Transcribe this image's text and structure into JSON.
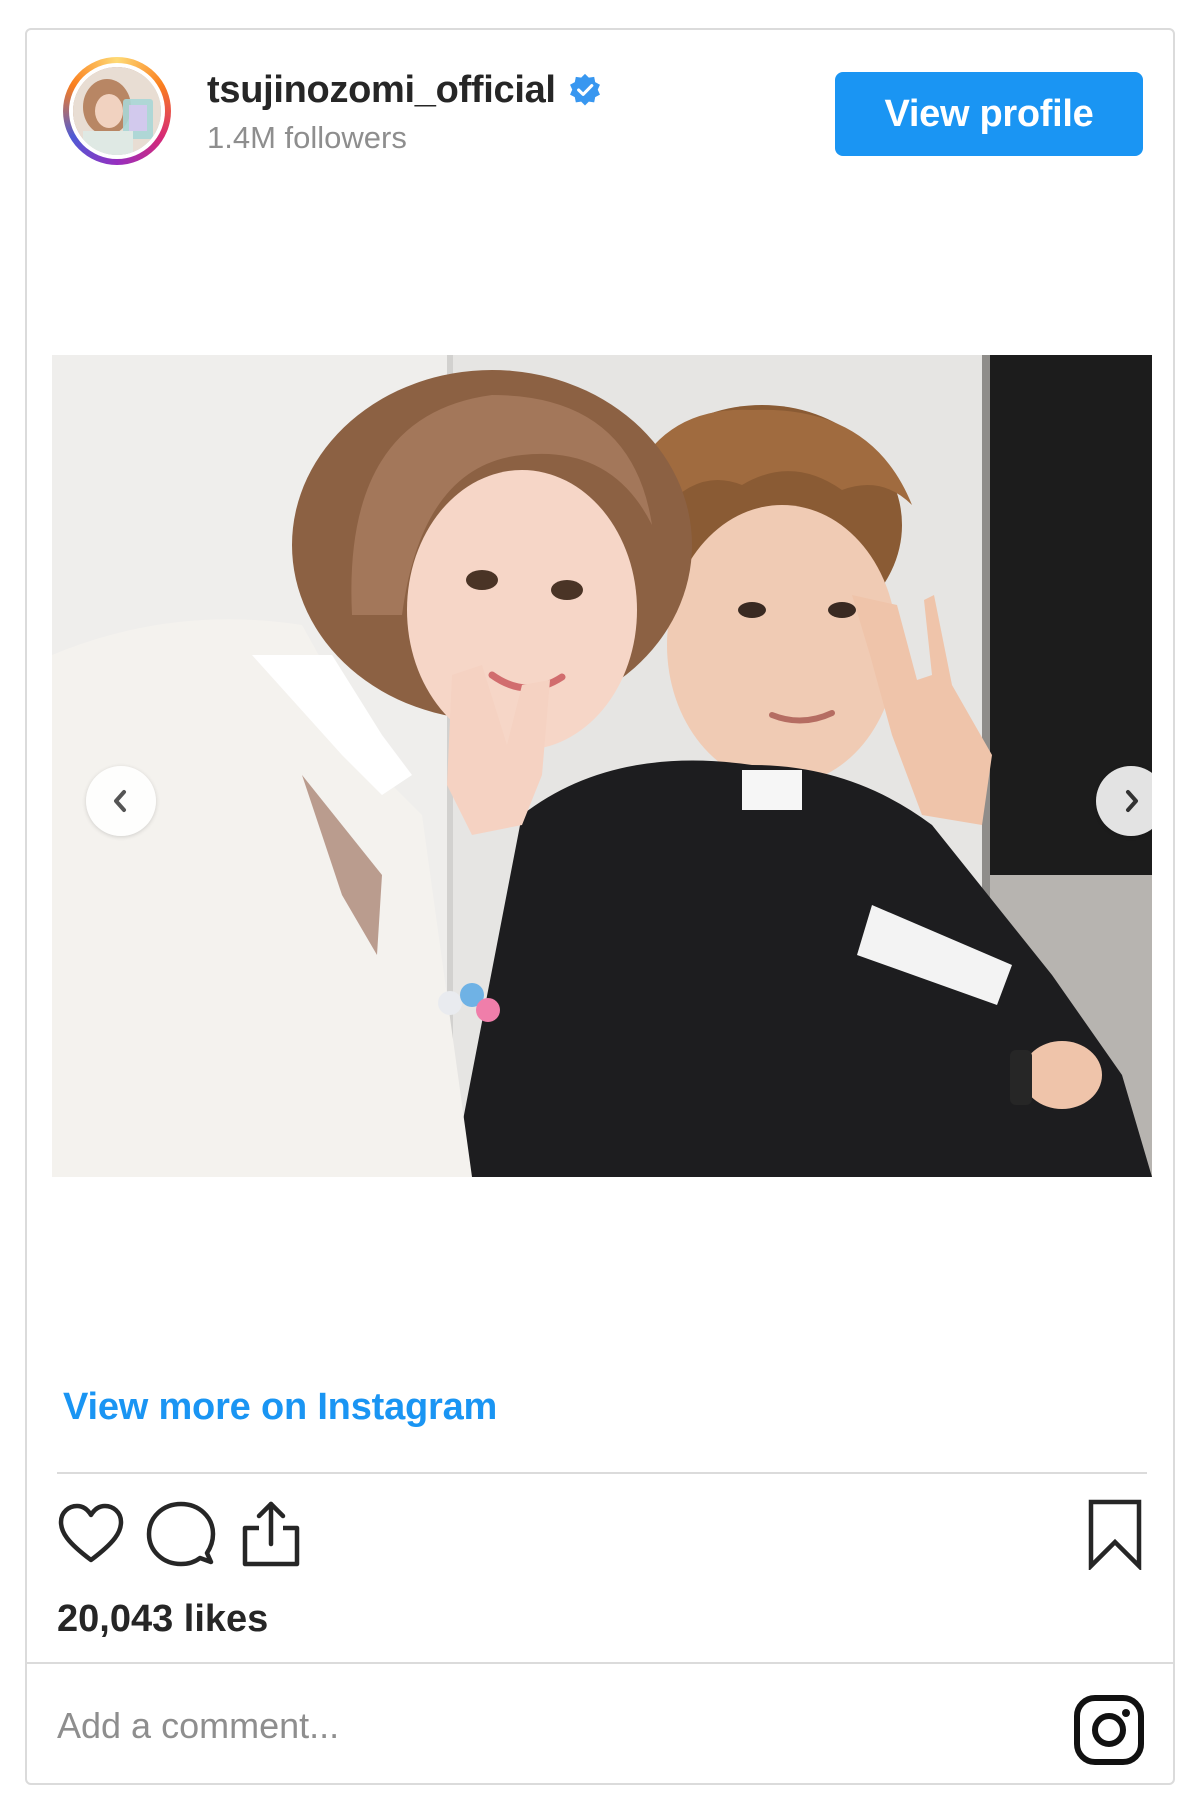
{
  "header": {
    "username": "tsujinozomi_official",
    "verified_icon": "verified-badge-icon",
    "followers": "1.4M followers",
    "view_profile_label": "View profile"
  },
  "post": {
    "image_label": "Selfie photo of two people making peace signs",
    "prev_icon": "chevron-left-icon",
    "next_icon": "chevron-right-icon"
  },
  "footer": {
    "view_more_label": "View more on Instagram",
    "likes": "20,043 likes",
    "comment_placeholder": "Add a comment..."
  },
  "icons": {
    "like": "heart-icon",
    "comment": "comment-bubble-icon",
    "share": "share-icon",
    "save": "bookmark-icon",
    "brand": "instagram-logo-icon"
  },
  "colors": {
    "accent": "#1a95f3",
    "text_primary": "#262626",
    "text_secondary": "#8e8e8e",
    "border": "#dbdbdb"
  }
}
